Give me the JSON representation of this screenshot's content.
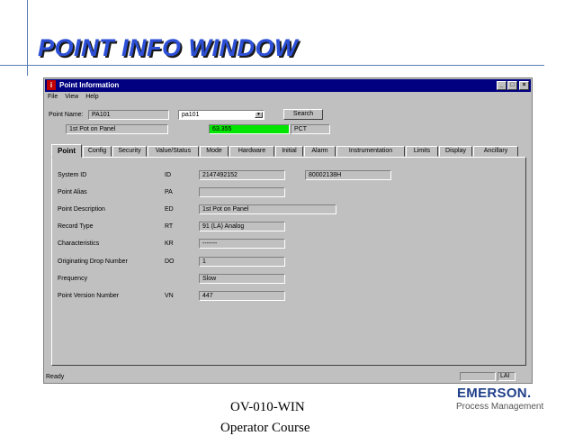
{
  "slide": {
    "title": "POINT INFO WINDOW",
    "footer_line1": "OV-010-WIN",
    "footer_line2": "Operator Course",
    "brand_name": "EMERSON.",
    "brand_sub": "Process Management"
  },
  "window": {
    "title": "Point Information",
    "icon_glyph": "i",
    "controls": {
      "minimize": "_",
      "maximize": "□",
      "close": "×"
    }
  },
  "menu": [
    "File",
    "View",
    "Help"
  ],
  "header": {
    "point_name_label": "Point Name:",
    "point_name_value": "PA101",
    "point_combo_value": "pa101",
    "search_label": "Search",
    "description": "1st Pot on Panel",
    "live_value": "63.355",
    "units": "PCT"
  },
  "tabs": [
    "Point",
    "Config",
    "Security",
    "Value/Status",
    "Mode",
    "Hardware",
    "Initial",
    "Alarm",
    "Instrumentation",
    "Limits",
    "Display",
    "Ancillary"
  ],
  "active_tab": "Point",
  "fields": [
    {
      "label": "System ID",
      "code": "ID",
      "value": "2147492152",
      "extra": "80002138H"
    },
    {
      "label": "Point Alias",
      "code": "PA",
      "value": ""
    },
    {
      "label": "Point Description",
      "code": "ED",
      "value": "1st Pot on Panel"
    },
    {
      "label": "Record Type",
      "code": "RT",
      "value": "91 (LA) Analog"
    },
    {
      "label": "Characteristics",
      "code": "KR",
      "value": "-------"
    },
    {
      "label": "Originating Drop Number",
      "code": "DO",
      "value": "1"
    },
    {
      "label": "Frequency",
      "code": "",
      "value": "Slow"
    },
    {
      "label": "Point Version Number",
      "code": "VN",
      "value": "447"
    }
  ],
  "status": {
    "text": "Ready",
    "type": "LAI"
  },
  "colors": {
    "title": "#2c4fd6",
    "titlebar": "#000080",
    "live_value_bg": "#00e600",
    "brand": "#1f3f8a"
  }
}
